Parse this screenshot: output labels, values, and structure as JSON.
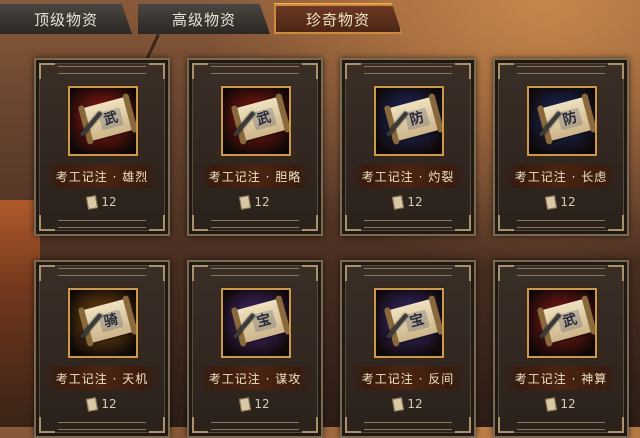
{
  "tabs": [
    {
      "label": "顶级物资"
    },
    {
      "label": "高级物资"
    },
    {
      "label": "珍奇物资"
    }
  ],
  "active_tab": "珍奇物资",
  "items": [
    {
      "name": "考工记注 · 雄烈",
      "glyph": "武",
      "bg": "#9a1a14",
      "cost": "12"
    },
    {
      "name": "考工记注 · 胆略",
      "glyph": "武",
      "bg": "#8a1812",
      "cost": "12"
    },
    {
      "name": "考工记注 · 灼裂",
      "glyph": "防",
      "bg": "#1e2a6a",
      "cost": "12"
    },
    {
      "name": "考工记注 · 长虑",
      "glyph": "防",
      "bg": "#1a2a64",
      "cost": "12"
    },
    {
      "name": "考工记注 · 天机",
      "glyph": "骑",
      "bg": "#7a4a10",
      "cost": "12"
    },
    {
      "name": "考工记注 · 谋攻",
      "glyph": "宝",
      "bg": "#4a2a7a",
      "cost": "12"
    },
    {
      "name": "考工记注 · 反间",
      "glyph": "宝",
      "bg": "#3a2a7a",
      "cost": "12"
    },
    {
      "name": "考工记注 · 神算",
      "glyph": "武",
      "bg": "#8a1a18",
      "cost": "12"
    }
  ]
}
